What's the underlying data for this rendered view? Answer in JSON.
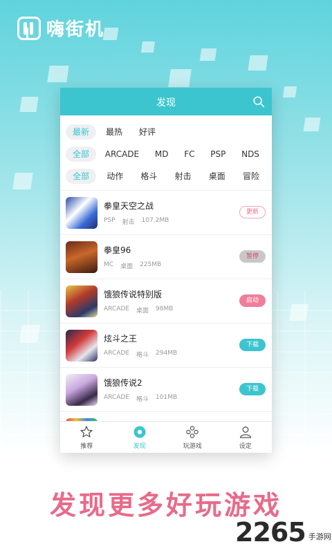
{
  "app": {
    "logo_text": "嗨街机"
  },
  "header": {
    "title": "发现"
  },
  "filters": {
    "sort": [
      {
        "label": "最新",
        "active": true
      },
      {
        "label": "最热",
        "active": false
      },
      {
        "label": "好评",
        "active": false
      }
    ],
    "platform": [
      {
        "label": "全部",
        "active": true
      },
      {
        "label": "ARCADE",
        "active": false
      },
      {
        "label": "MD",
        "active": false
      },
      {
        "label": "FC",
        "active": false
      },
      {
        "label": "PSP",
        "active": false
      },
      {
        "label": "NDS",
        "active": false
      }
    ],
    "genre": [
      {
        "label": "全部",
        "active": true
      },
      {
        "label": "动作",
        "active": false
      },
      {
        "label": "格斗",
        "active": false
      },
      {
        "label": "射击",
        "active": false
      },
      {
        "label": "桌面",
        "active": false
      },
      {
        "label": "冒险",
        "active": false
      }
    ]
  },
  "games": [
    {
      "name": "拳皇天空之战",
      "platform": "PSP",
      "genre": "射击",
      "size": "107.2MB",
      "action": "更新",
      "action_type": "update"
    },
    {
      "name": "拳皇96",
      "platform": "MC",
      "genre": "桌面",
      "size": "225MB",
      "action": "暂停",
      "action_type": "pause"
    },
    {
      "name": "饿狼传说特别版",
      "platform": "ARCADE",
      "genre": "桌面",
      "size": "98MB",
      "action": "启动",
      "action_type": "launch"
    },
    {
      "name": "炫斗之王",
      "platform": "ARCADE",
      "genre": "格斗",
      "size": "294MB",
      "action": "下载",
      "action_type": "download"
    },
    {
      "name": "饿狼传说2",
      "platform": "ARCADE",
      "genre": "格斗",
      "size": "101MB",
      "action": "下载",
      "action_type": "download"
    }
  ],
  "tabbar": [
    {
      "label": "推荐",
      "icon": "star-icon",
      "active": false
    },
    {
      "label": "发现",
      "icon": "discover-icon",
      "active": true
    },
    {
      "label": "玩游戏",
      "icon": "gamepad-icon",
      "active": false
    },
    {
      "label": "设定",
      "icon": "user-icon",
      "active": false
    }
  ],
  "promo": {
    "slogan": "发现更多好玩游戏"
  },
  "brand": {
    "number": "2265",
    "sub": "手游网"
  },
  "colors": {
    "accent": "#3cc5cf",
    "pink": "#e86a8a"
  }
}
